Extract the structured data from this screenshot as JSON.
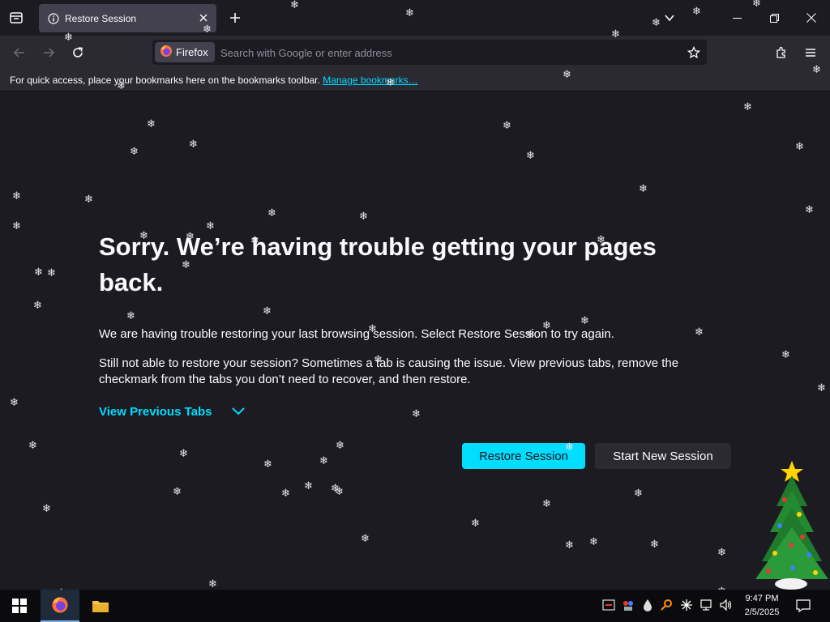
{
  "tab": {
    "title": "Restore Session"
  },
  "navbar": {
    "identity_label": "Firefox",
    "url_placeholder": "Search with Google or enter address"
  },
  "bookmarks": {
    "message": "For quick access, place your bookmarks here on the bookmarks toolbar.",
    "manage_link": "Manage bookmarks…"
  },
  "content": {
    "title": "Sorry. We’re having trouble getting your pages back.",
    "paragraph1": "We are having trouble restoring your last browsing session. Select Restore Session to try again.",
    "paragraph2": "Still not able to restore your session? Sometimes a tab is causing the issue. View previous tabs, remove the checkmark from the tabs you don’t need to recover, and then restore.",
    "view_previous": "View Previous Tabs",
    "restore_button": "Restore Session",
    "new_session_button": "Start New Session"
  },
  "taskbar": {
    "time": "9:47 PM",
    "date": "2/5/2025"
  },
  "colors": {
    "accent": "#00ddff",
    "page_bg": "#1c1b22",
    "toolbar_bg": "#2b2a33"
  }
}
